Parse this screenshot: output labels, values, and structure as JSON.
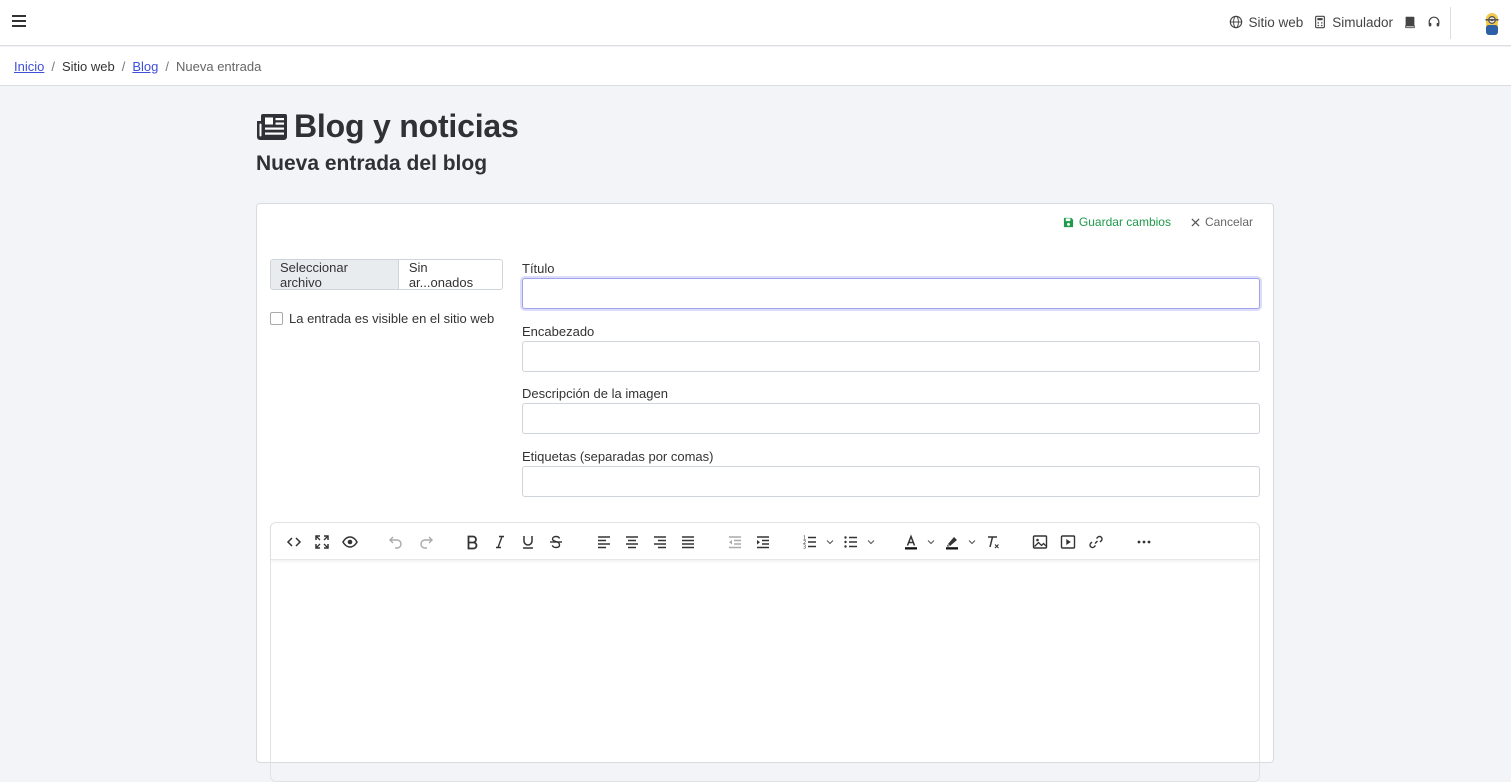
{
  "topbar": {
    "nav": [
      {
        "label": "Sitio web",
        "icon": "globe-icon"
      },
      {
        "label": "Simulador",
        "icon": "calculator-icon"
      }
    ],
    "icons": [
      "book-icon",
      "headset-icon"
    ]
  },
  "breadcrumb": {
    "home": "Inicio",
    "section": "Sitio web",
    "blog": "Blog",
    "current": "Nueva entrada"
  },
  "page": {
    "title": "Blog y noticias",
    "subtitle": "Nueva entrada del blog"
  },
  "actions": {
    "save": "Guardar cambios",
    "cancel": "Cancelar"
  },
  "file": {
    "button": "Seleccionar archivo",
    "status": "Sin ar...onados"
  },
  "visible_checkbox": {
    "label": "La entrada es visible en el sitio web",
    "checked": false
  },
  "fields": {
    "title": {
      "label": "Título",
      "value": ""
    },
    "header": {
      "label": "Encabezado",
      "value": ""
    },
    "image_desc": {
      "label": "Descripción de la imagen",
      "value": ""
    },
    "tags": {
      "label": "Etiquetas (separadas por comas)",
      "value": ""
    }
  },
  "colors": {
    "link": "#3e4fd8",
    "save": "#1f9a4a",
    "background": "#f3f4f7"
  }
}
